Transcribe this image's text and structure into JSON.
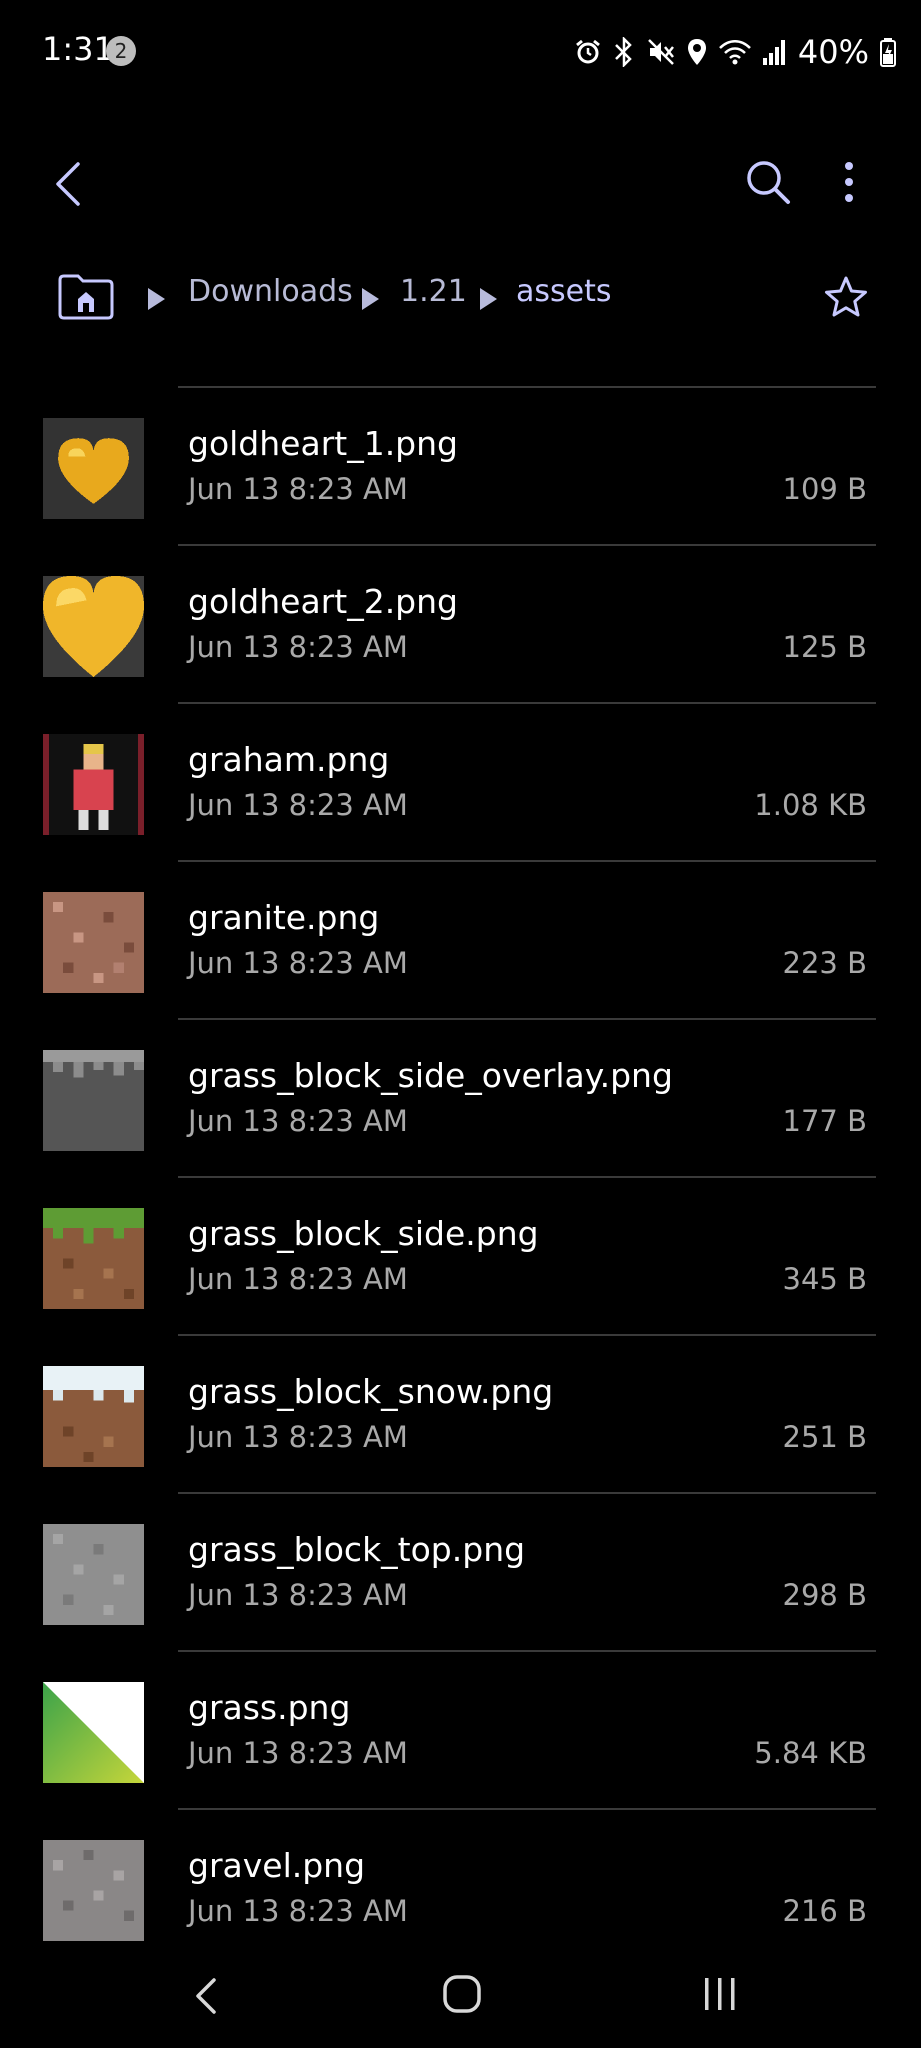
{
  "status_bar": {
    "time": "1:31",
    "notification_count": "2",
    "battery": "40%"
  },
  "app_bar": {
    "back_icon": "chevron-left-icon",
    "search_icon": "search-icon",
    "more_icon": "more-vertical-icon"
  },
  "breadcrumb": {
    "home_icon": "home-folder-icon",
    "items": [
      "Downloads",
      "1.21",
      "assets"
    ],
    "favorite_icon": "star-outline-icon"
  },
  "files": [
    {
      "name": "goldheart_1.png",
      "date": "Jun 13 8:23 AM",
      "size": "109 B",
      "thumb": "goldheart1"
    },
    {
      "name": "goldheart_2.png",
      "date": "Jun 13 8:23 AM",
      "size": "125 B",
      "thumb": "goldheart2"
    },
    {
      "name": "graham.png",
      "date": "Jun 13 8:23 AM",
      "size": "1.08 KB",
      "thumb": "graham"
    },
    {
      "name": "granite.png",
      "date": "Jun 13 8:23 AM",
      "size": "223 B",
      "thumb": "granite"
    },
    {
      "name": "grass_block_side_overlay.png",
      "date": "Jun 13 8:23 AM",
      "size": "177 B",
      "thumb": "overlay"
    },
    {
      "name": "grass_block_side.png",
      "date": "Jun 13 8:23 AM",
      "size": "345 B",
      "thumb": "grassside"
    },
    {
      "name": "grass_block_snow.png",
      "date": "Jun 13 8:23 AM",
      "size": "251 B",
      "thumb": "snow"
    },
    {
      "name": "grass_block_top.png",
      "date": "Jun 13 8:23 AM",
      "size": "298 B",
      "thumb": "top"
    },
    {
      "name": "grass.png",
      "date": "Jun 13 8:23 AM",
      "size": "5.84 KB",
      "thumb": "grass"
    },
    {
      "name": "gravel.png",
      "date": "Jun 13 8:23 AM",
      "size": "216 B",
      "thumb": "gravel"
    }
  ],
  "colors": {
    "accent": "#c7c9ff",
    "background": "#000000",
    "secondary_text": "#a9a9a9",
    "divider": "#3a3a3a"
  },
  "nav_bar": {
    "back_icon": "nav-back-icon",
    "home_icon": "nav-home-icon",
    "recents_icon": "nav-recents-icon"
  }
}
